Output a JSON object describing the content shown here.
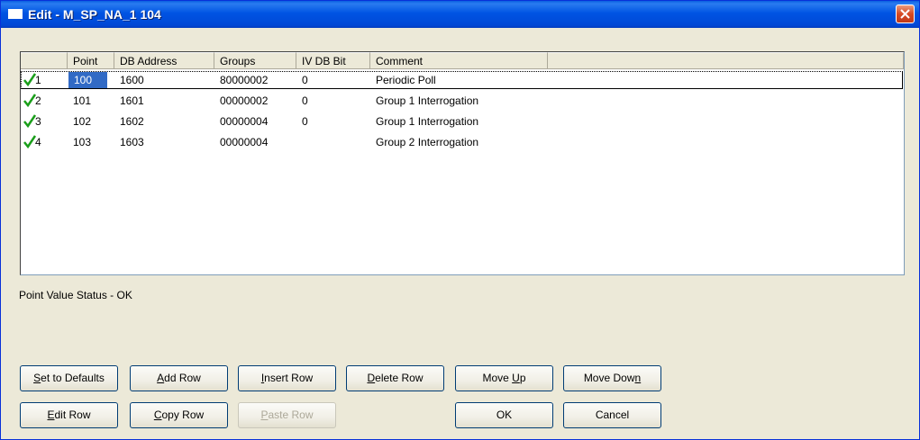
{
  "window": {
    "title": "Edit - M_SP_NA_1 104"
  },
  "table": {
    "columns": [
      "",
      "Point",
      "DB Address",
      "Groups",
      "IV DB Bit",
      "Comment"
    ],
    "rows": [
      {
        "index": "1",
        "point": "100",
        "db_address": "1600",
        "groups": "80000002",
        "iv_db_bit": "0",
        "comment": "Periodic Poll",
        "selected": true
      },
      {
        "index": "2",
        "point": "101",
        "db_address": "1601",
        "groups": "00000002",
        "iv_db_bit": "0",
        "comment": "Group 1 Interrogation"
      },
      {
        "index": "3",
        "point": "102",
        "db_address": "1602",
        "groups": "00000004",
        "iv_db_bit": "0",
        "comment": "Group 1 Interrogation"
      },
      {
        "index": "4",
        "point": "103",
        "db_address": "1603",
        "groups": "00000004",
        "iv_db_bit": "",
        "comment": "Group 2 Interrogation"
      }
    ],
    "check_color": "#1a9e1a",
    "selection_color": "#316ac5"
  },
  "status": {
    "text": "Point Value Status - OK"
  },
  "buttons": {
    "set_defaults": {
      "pre": "",
      "u": "S",
      "post": "et to Defaults"
    },
    "add_row": {
      "pre": "",
      "u": "A",
      "post": "dd Row"
    },
    "insert_row": {
      "pre": "",
      "u": "I",
      "post": "nsert Row"
    },
    "delete_row": {
      "pre": "",
      "u": "D",
      "post": "elete Row"
    },
    "move_up": {
      "pre": "Move ",
      "u": "U",
      "post": "p"
    },
    "move_down": {
      "pre": "Move Dow",
      "u": "n",
      "post": ""
    },
    "edit_row": {
      "pre": "",
      "u": "E",
      "post": "dit Row"
    },
    "copy_row": {
      "pre": "",
      "u": "C",
      "post": "opy Row"
    },
    "paste_row": {
      "pre": "",
      "u": "P",
      "post": "aste Row"
    },
    "ok": {
      "pre": "OK",
      "u": "",
      "post": ""
    },
    "cancel": {
      "pre": "Cancel",
      "u": "",
      "post": ""
    }
  }
}
